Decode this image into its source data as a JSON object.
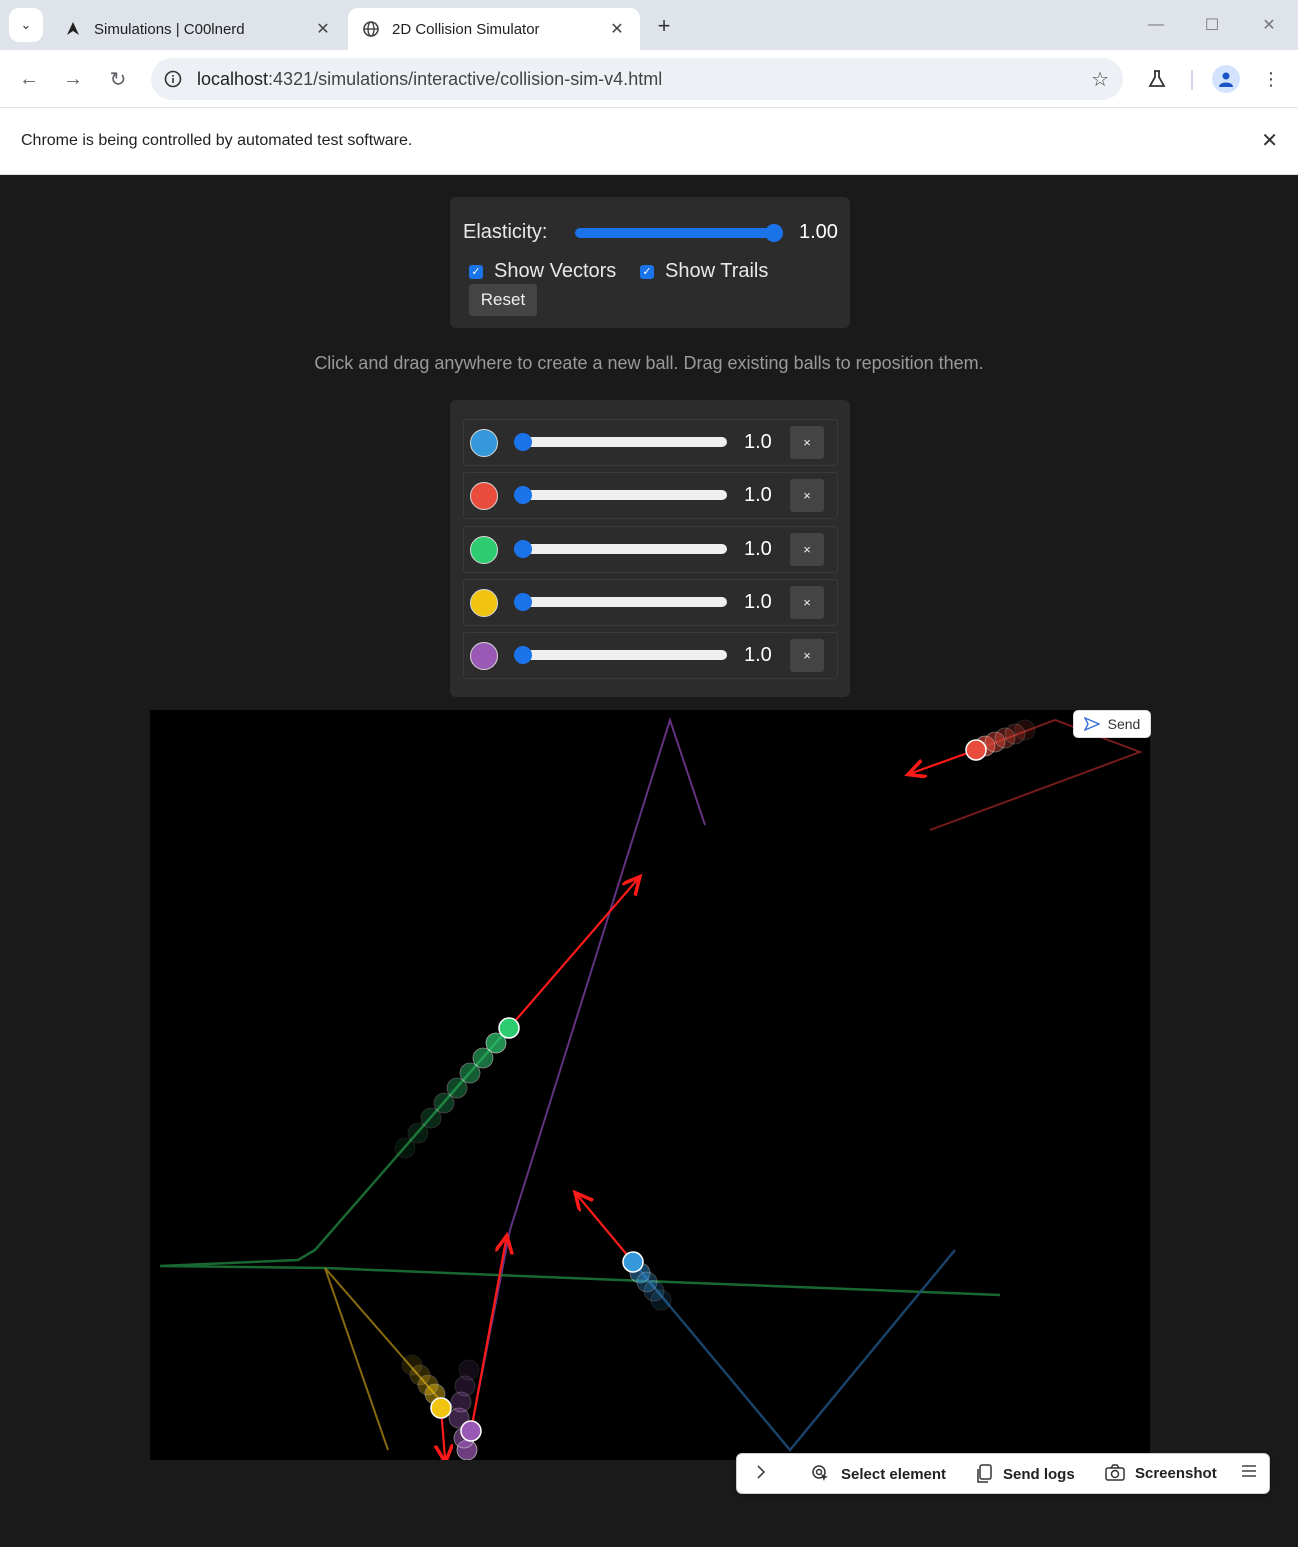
{
  "browser": {
    "tabs": [
      {
        "title": "Simulations | C00lnerd",
        "active": false
      },
      {
        "title": "2D Collision Simulator",
        "active": true
      }
    ],
    "url_host": "localhost",
    "url_path": ":4321/simulations/interactive/collision-sim-v4.html",
    "infobar_message": "Chrome is being controlled by automated test software."
  },
  "controls": {
    "elasticity_label": "Elasticity:",
    "elasticity_value": "1.00",
    "elasticity_fraction": 1.0,
    "show_vectors_label": "Show Vectors",
    "show_vectors_checked": true,
    "show_trails_label": "Show Trails",
    "show_trails_checked": true,
    "reset_label": "Reset"
  },
  "hint": "Click and drag anywhere to create a new ball. Drag existing balls to reposition them.",
  "balls": [
    {
      "color": "#3498db",
      "mass": "1.0",
      "slider_fraction": 0.0,
      "remove_label": "×"
    },
    {
      "color": "#e74c3c",
      "mass": "1.0",
      "slider_fraction": 0.0,
      "remove_label": "×"
    },
    {
      "color": "#2ecc71",
      "mass": "1.0",
      "slider_fraction": 0.0,
      "remove_label": "×"
    },
    {
      "color": "#f1c40f",
      "mass": "1.0",
      "slider_fraction": 0.0,
      "remove_label": "×"
    },
    {
      "color": "#9b59b6",
      "mass": "1.0",
      "slider_fraction": 0.0,
      "remove_label": "×"
    }
  ],
  "send_label": "Send",
  "devbar": {
    "select_element": "Select element",
    "send_logs": "Send logs",
    "screenshot": "Screenshot"
  }
}
